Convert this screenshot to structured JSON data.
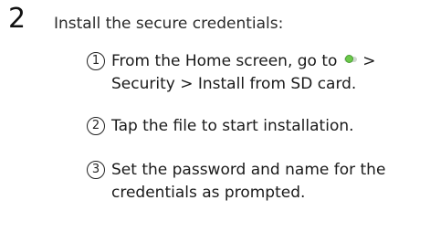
{
  "step": {
    "number": "2",
    "heading": "Install the secure credentials:"
  },
  "substeps": [
    {
      "marker": "1",
      "line1_before_icon": "From the Home screen, go to",
      "line1_after_icon": ">",
      "line2": "Security > Install from SD card.",
      "icon": "settings-icon"
    },
    {
      "marker": "2",
      "line1": "Tap the file to start installation."
    },
    {
      "marker": "3",
      "line1": "Set the password and name for the",
      "line2": "credentials as prompted."
    }
  ],
  "colors": {
    "text": "#1a1a1a",
    "icon_accent": "#6cc94a"
  }
}
